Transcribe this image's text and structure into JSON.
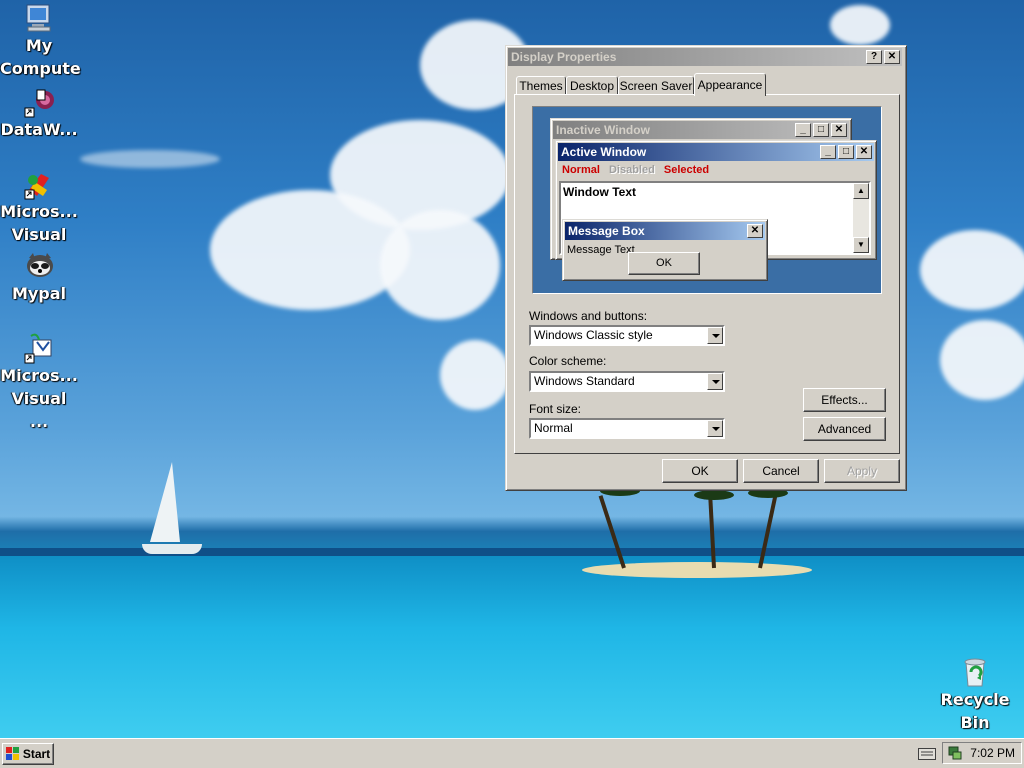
{
  "desktop_icons": [
    {
      "label": "My Compute",
      "icon": "my-computer-icon"
    },
    {
      "label": "DataW...",
      "icon": "datawatch-icon"
    },
    {
      "label": "Micros... Visual ...",
      "icon": "visual-studio-icon"
    },
    {
      "label": "Mypal",
      "icon": "mypal-browser-icon"
    },
    {
      "label": "Micros... Visual ...",
      "icon": "visual-foxpro-icon"
    },
    {
      "label": "Recycle Bin",
      "icon": "recycle-bin-icon"
    }
  ],
  "dialog": {
    "title": "Display Properties",
    "help_glyph": "?",
    "close_glyph": "✕",
    "tabs": [
      {
        "label": "Themes",
        "selected": false
      },
      {
        "label": "Desktop",
        "selected": false
      },
      {
        "label": "Screen Saver",
        "selected": false
      },
      {
        "label": "Appearance",
        "selected": true
      }
    ],
    "preview": {
      "inactive_title": "Inactive Window",
      "active_title": "Active Window",
      "menu_normal": "Normal",
      "menu_disabled": "Disabled",
      "menu_selected": "Selected",
      "window_text": "Window Text",
      "message_box_title": "Message Box",
      "message_text": "Message Text",
      "ok_label": "OK"
    },
    "windows_buttons_label": "Windows and buttons:",
    "windows_buttons_value": "Windows Classic style",
    "color_scheme_label": "Color scheme:",
    "color_scheme_value": "Windows Standard",
    "font_size_label": "Font size:",
    "font_size_value": "Normal",
    "effects_label": "Effects...",
    "advanced_label": "Advanced",
    "ok_label": "OK",
    "cancel_label": "Cancel",
    "apply_label": "Apply",
    "apply_enabled": false
  },
  "taskbar": {
    "start_label": "Start",
    "clock": "7:02 PM"
  },
  "colors": {
    "face": "#d4d0c8",
    "active_title_start": "#0a246a",
    "active_title_end": "#a6caf0",
    "inactive_title": "#808080",
    "selected_menu_text": "#cc0000",
    "preview_desktop": "#3a6ea5"
  }
}
